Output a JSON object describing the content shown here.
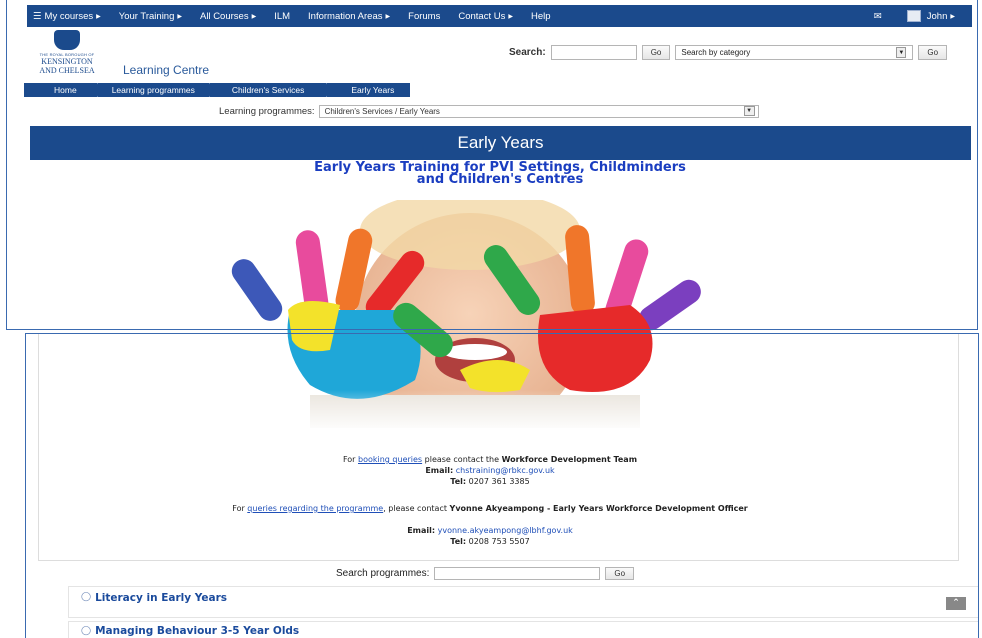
{
  "topnav": {
    "items": [
      {
        "label": "My courses",
        "icon": "menu-icon"
      },
      {
        "label": "Your Training"
      },
      {
        "label": "All Courses"
      },
      {
        "label": "ILM"
      },
      {
        "label": "Information Areas"
      },
      {
        "label": "Forums"
      },
      {
        "label": "Contact Us"
      },
      {
        "label": "Help"
      }
    ],
    "user": "John"
  },
  "header": {
    "logo_small": "THE ROYAL BOROUGH OF",
    "logo_line1": "KENSINGTON",
    "logo_line2": "AND CHELSEA",
    "site_title": "Learning Centre",
    "search_label": "Search:",
    "search_value": "",
    "go1": "Go",
    "category_select": "Search by category",
    "go2": "Go"
  },
  "breadcrumb": [
    "Home",
    "Learning programmes",
    "Children's Services",
    "Early Years"
  ],
  "programmes": {
    "label": "Learning programmes:",
    "selected": "Children's Services / Early Years"
  },
  "banner": "Early Years",
  "subtitle_line1": "Early Years Training for PVI Settings, Childminders",
  "subtitle_line2": "and Children's Centres",
  "contact1": {
    "prefix": "For",
    "link": "booking queries",
    "middle": "please contact the",
    "team": "Workforce Development Team",
    "email_label": "Email:",
    "email": "chstraining@rbkc.gov.uk",
    "tel_label": "Tel:",
    "tel": "0207 361 3385"
  },
  "contact2": {
    "prefix": "For",
    "link": "queries regarding the programme",
    "middle": ", please contact",
    "person": "Yvonne Akyeampong - Early Years Workforce Development Officer",
    "email_label": "Email:",
    "email": "yvonne.akyeampong@lbhf.gov.uk",
    "tel_label": "Tel:",
    "tel": "0208 753 5507"
  },
  "search_programmes": {
    "label": "Search programmes:",
    "value": "",
    "button": "Go"
  },
  "courses": [
    {
      "title": "Literacy in Early Years"
    },
    {
      "title": "Managing Behaviour 3-5 Year Olds"
    }
  ],
  "colors": {
    "brand": "#1b4a8c",
    "heading": "#1a3dc0",
    "link": "#1f4fb8"
  }
}
